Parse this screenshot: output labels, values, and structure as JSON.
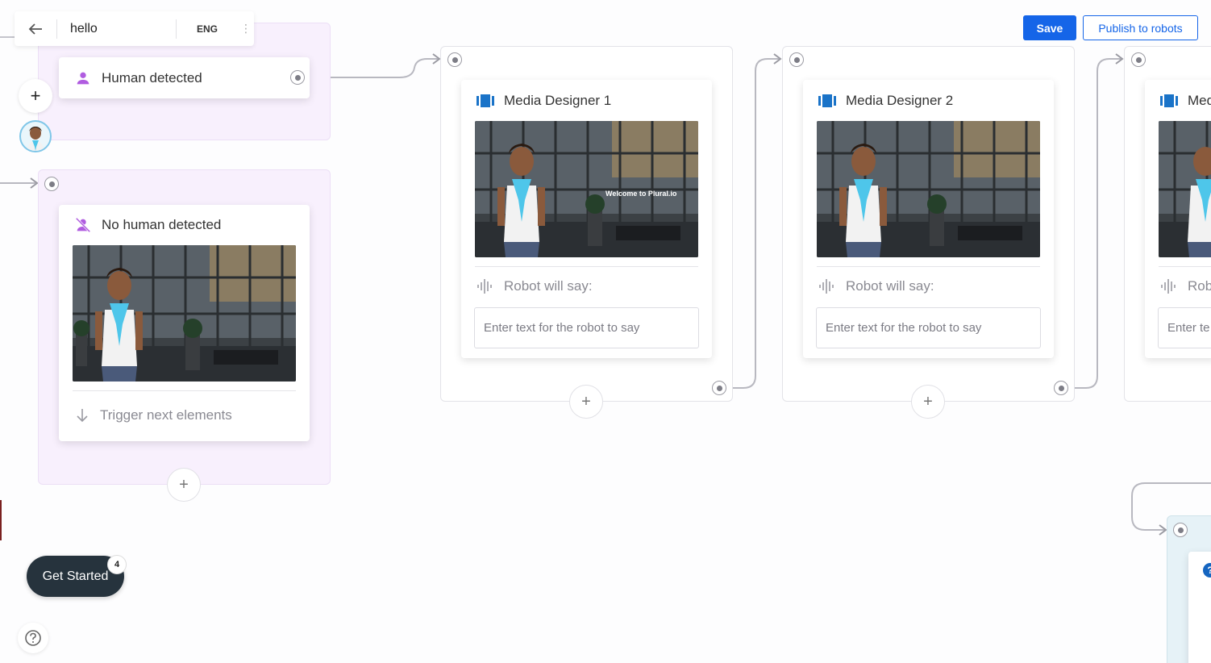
{
  "topbar": {
    "back_icon": "arrow-left-icon",
    "title": "hello",
    "language": "ENG",
    "menu_icon": "kebab-vertical-icon"
  },
  "actions": {
    "save_label": "Save",
    "publish_label": "Publish to robots",
    "accent_color": "#1565e8"
  },
  "nodes": {
    "human_detected": {
      "label": "Human detected",
      "icon": "person-icon"
    },
    "no_human_detected": {
      "label": "No human detected",
      "icon": "person-off-icon",
      "trigger_label": "Trigger next elements",
      "trigger_icon": "arrow-down-icon"
    },
    "media_1": {
      "label": "Media Designer 1",
      "icon": "media-icon",
      "overlay_text": "Welcome to Plural.io",
      "say_label": "Robot will say:",
      "say_placeholder": "Enter text for the robot to say"
    },
    "media_2": {
      "label": "Media Designer 2",
      "icon": "media-icon",
      "say_label": "Robot will say:",
      "say_placeholder": "Enter text for the robot to say"
    },
    "media_3_partial": {
      "label": "Med",
      "say_label": "Rob",
      "say_placeholder": "Enter te"
    }
  },
  "bottom": {
    "get_started_label": "Get Started",
    "get_started_badge": "4",
    "help_icon": "help-circle-icon"
  },
  "colors": {
    "purple_group": "#f8f0fd",
    "node_icon_purple": "#b05ce0",
    "media_icon_blue": "#1a73c8",
    "dark_button": "#26333d"
  }
}
